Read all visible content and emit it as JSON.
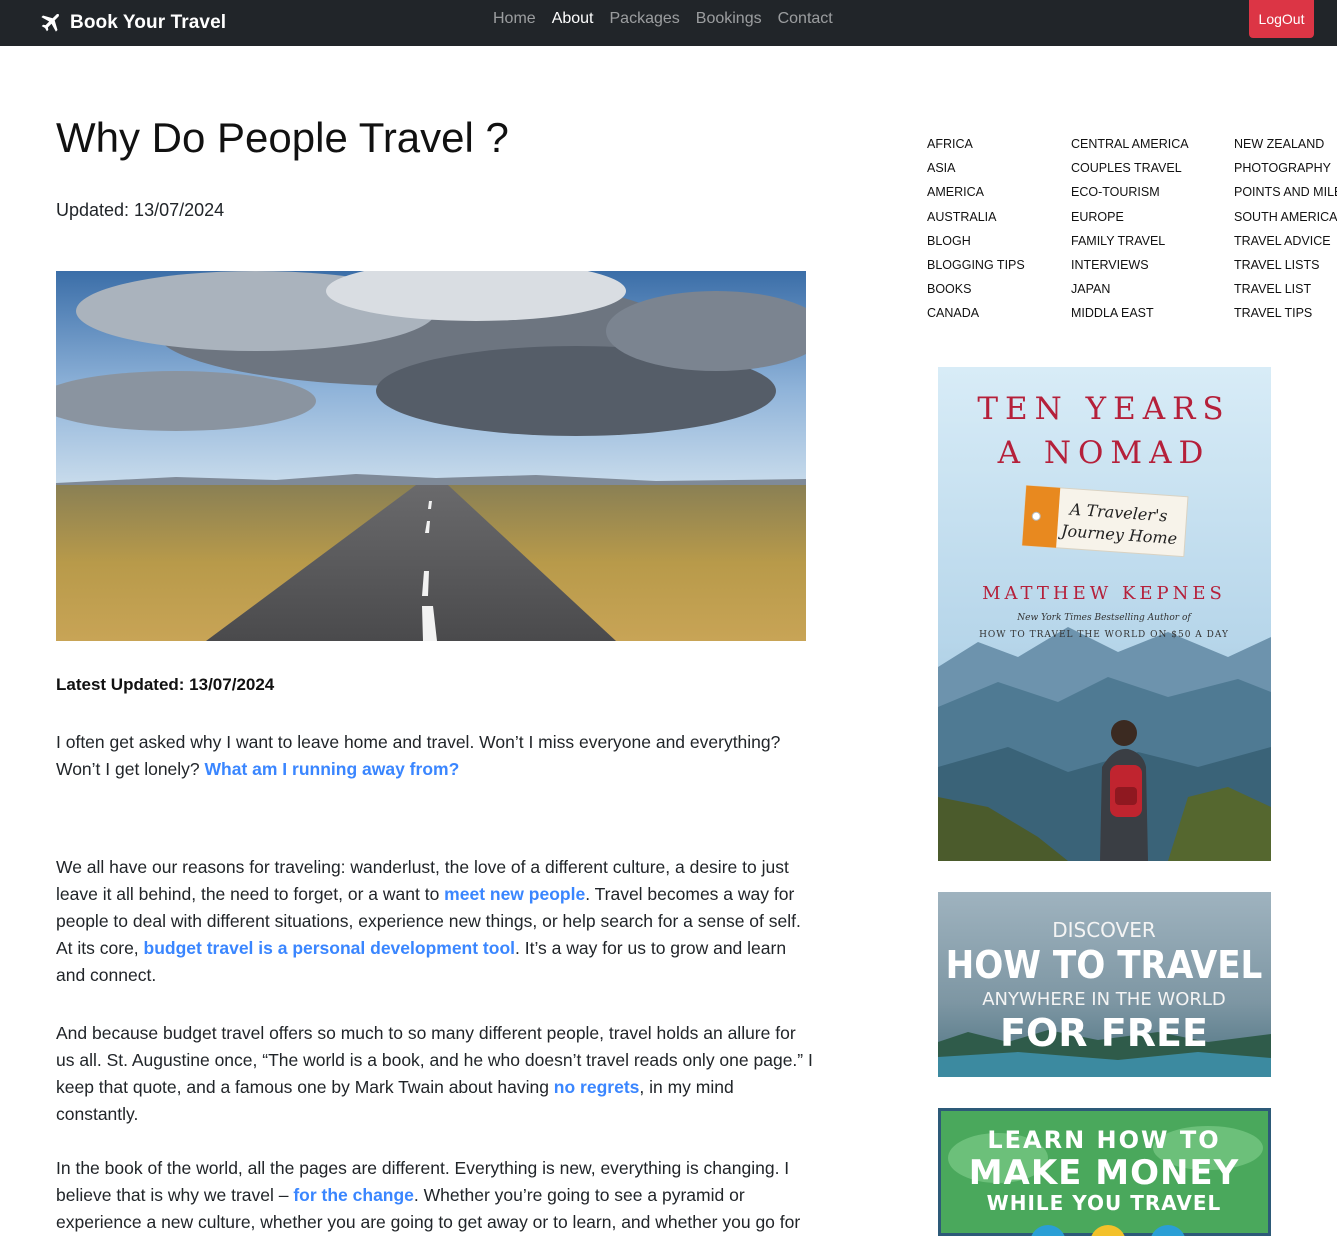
{
  "nav": {
    "brand": "Book Your Travel",
    "links": [
      "Home",
      "About",
      "Packages",
      "Bookings",
      "Contact"
    ],
    "active_link": "About",
    "logout": "LogOut"
  },
  "article": {
    "title": "Why Do People Travel ?",
    "updated": "Updated: 13/07/2024",
    "latest_updated": "Latest Updated: 13/07/2024",
    "p1": {
      "text": "I often get asked why I want to leave home and travel. Won’t I miss everyone and everything? Won’t I get lonely? ",
      "link": "What am I running away from?"
    },
    "p2": {
      "t1": "We all have our reasons for traveling: wanderlust, the love of a different culture, a desire to just leave it all behind, the need to forget, or a want to ",
      "link1": "meet new people",
      "t2": ". Travel becomes a way for people to deal with different situations, experience new things, or help search for a sense of self. At its core, ",
      "link2": "budget travel is a personal development tool",
      "t3": ". It’s a way for us to grow and learn and connect."
    },
    "p3": {
      "t1": "And because budget travel offers so much to so many different people, travel holds an allure for us all. St. Augustine once, “The world is a book, and he who doesn’t travel reads only one page.” I keep that quote, and a famous one by Mark Twain about having ",
      "link1": "no regrets",
      "t2": ", in my mind constantly."
    },
    "p4": {
      "t1": "In the book of the world, all the pages are different. Everything is new, everything is changing. I believe that is why we travel – ",
      "link1": "for the change",
      "t2": ". Whether you’re going to see a pyramid or experience a new culture, whether you are going to get away or to learn, and whether you go for"
    }
  },
  "categories": {
    "col1": [
      "AFRICA",
      "ASIA",
      "AMERICA",
      "AUSTRALIA",
      "BLOGH",
      "BLOGGING TIPS",
      "BOOKS",
      "CANADA"
    ],
    "col2": [
      "CENTRAL AMERICA",
      "COUPLES TRAVEL",
      "ECO-TOURISM",
      "EUROPE",
      "FAMILY TRAVEL",
      "INTERVIEWS",
      "JAPAN",
      "MIDDLA EAST"
    ],
    "col3": [
      "NEW ZEALAND",
      "PHOTOGRAPHY",
      "POINTS AND MILES",
      "SOUTH AMERICA",
      "TRAVEL ADVICE",
      "TRAVEL LISTS",
      "TRAVEL LIST",
      "TRAVEL TIPS"
    ]
  },
  "ads": {
    "book": {
      "title_line1": "TEN YEARS",
      "title_line2": "A NOMAD",
      "tag_line1": "A Traveler's",
      "tag_line2": "Journey Home",
      "author": "MATTHEW KEPNES",
      "sub1": "New York Times Bestselling Author of",
      "sub2": "HOW TO TRAVEL THE WORLD ON $50 A DAY"
    },
    "discover": {
      "line1": "DISCOVER",
      "line2": "HOW TO TRAVEL",
      "line3": "ANYWHERE IN THE WORLD",
      "line4": "FOR FREE"
    },
    "money": {
      "line1": "LEARN HOW TO",
      "line2": "MAKE MONEY",
      "line3": "WHILE YOU TRAVEL"
    }
  },
  "colors": {
    "navbar": "#212529",
    "logout": "#dc3545",
    "link": "#3a86ff",
    "book_title": "#b5203a"
  }
}
